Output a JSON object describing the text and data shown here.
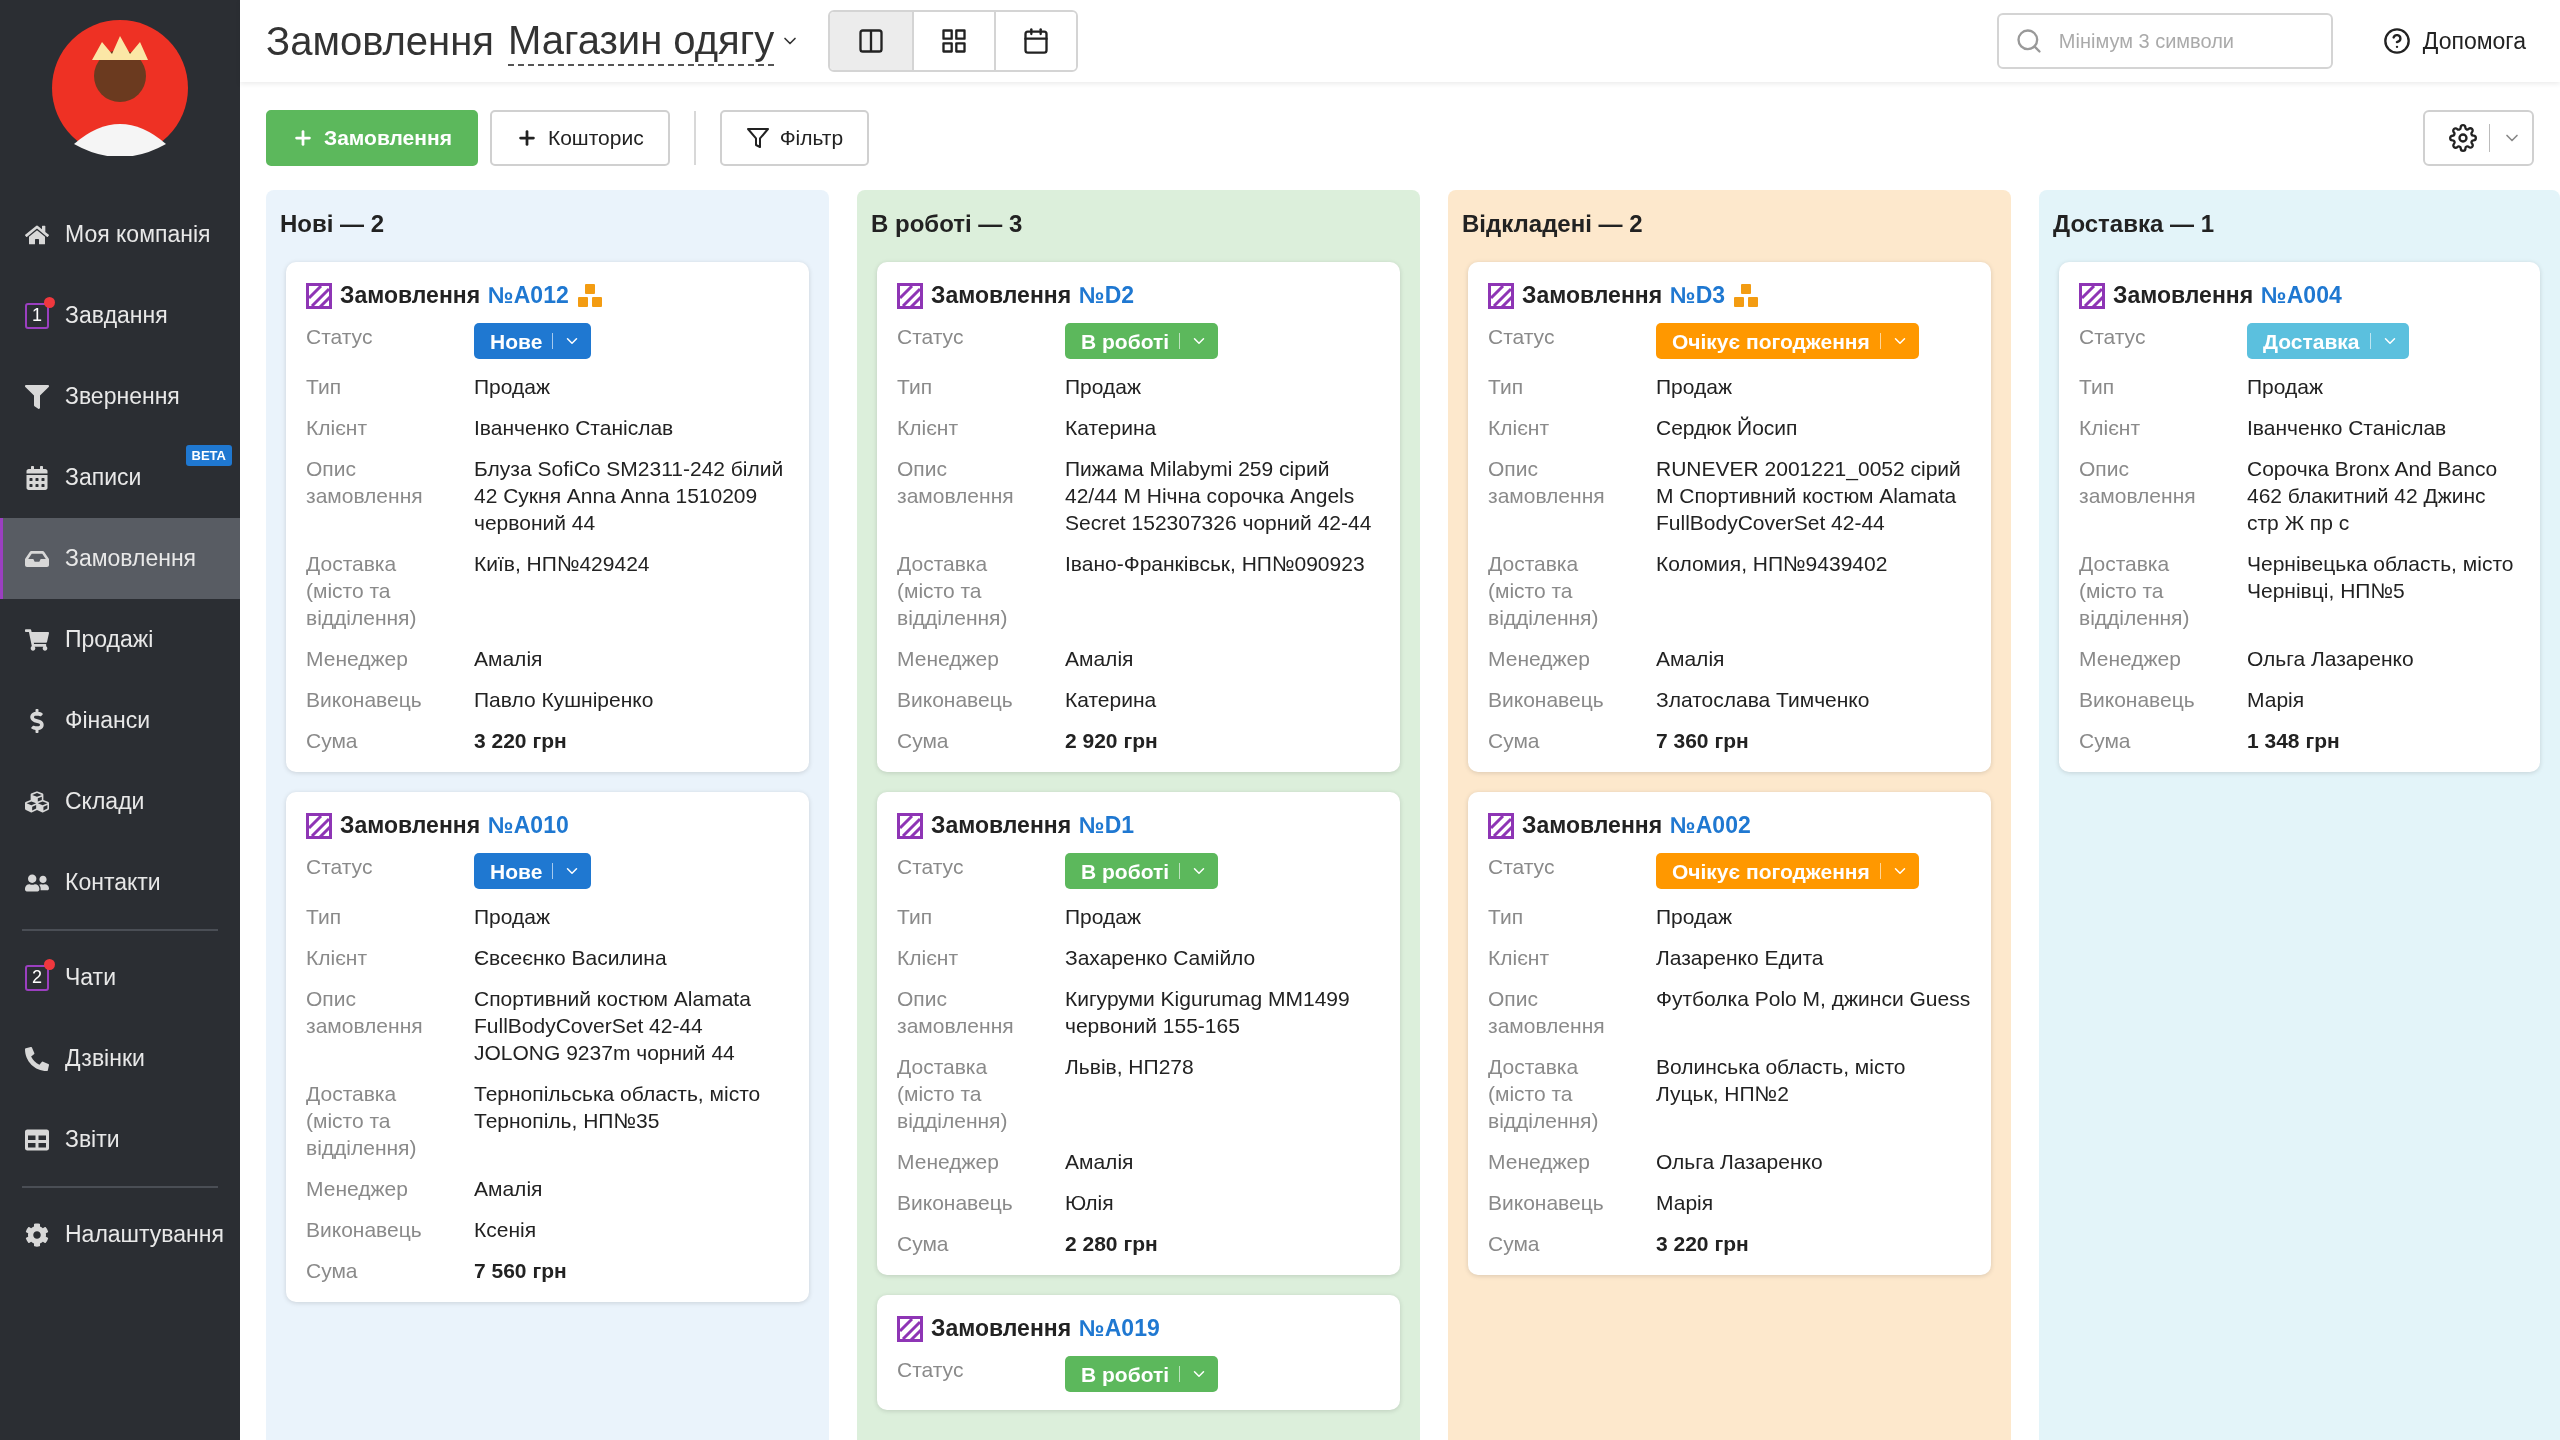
{
  "sidebar": {
    "groups": [
      [
        {
          "label": "Моя компанія",
          "selected": false
        },
        {
          "label": "Завдання",
          "selected": false,
          "counter": "1",
          "unread": true
        },
        {
          "label": "Звернення",
          "selected": false
        },
        {
          "label": "Записи",
          "selected": false,
          "tag": "BETA"
        },
        {
          "label": "Замовлення",
          "selected": true
        },
        {
          "label": "Продажі",
          "selected": false
        },
        {
          "label": "Фінанси",
          "selected": false
        },
        {
          "label": "Склади",
          "selected": false
        },
        {
          "label": "Контакти",
          "selected": false
        }
      ],
      [
        {
          "label": "Чати",
          "selected": false,
          "counter": "2",
          "unread": true
        },
        {
          "label": "Дзвінки",
          "selected": false
        },
        {
          "label": "Звіти",
          "selected": false
        }
      ],
      [
        {
          "label": "Налаштування",
          "selected": false
        }
      ]
    ]
  },
  "header": {
    "title": "Замовлення",
    "store": "Магазин одягу",
    "views": [
      {
        "selected": true
      },
      {
        "selected": false
      },
      {
        "selected": false
      }
    ],
    "search": {
      "placeholder": "Мінімум 3 символи"
    },
    "help": "Допомога"
  },
  "toolbar": {
    "new_order": "Замовлення",
    "estimate": "Кошторис",
    "filter": "Фільтр"
  },
  "columns": [
    {
      "title": "Нові — 2",
      "color": "#eaf3fb",
      "cards": [
        {
          "title": "Замовлення",
          "number": "№A012",
          "stock": true,
          "status": {
            "name": "Статус",
            "label": "Нове",
            "color": "#1f78d1"
          },
          "fields": [
            {
              "label": "Тип",
              "value": "Продаж"
            },
            {
              "label": "Клієнт",
              "value": "Іванченко Станіслав"
            },
            {
              "label": "Опис замовлення",
              "value": "Блуза SofiCo SM2311-242 білий 42 Сукня Anna Anna 1510209 червоний 44"
            },
            {
              "label": "Доставка (місто та відділення)",
              "value": "Київ, НП№429424"
            },
            {
              "label": "Менеджер",
              "value": "Амалія"
            },
            {
              "label": "Виконавець",
              "value": "Павло Кушніренко"
            },
            {
              "label": "Сума",
              "value": "3 220 грн",
              "kind": "total"
            }
          ]
        },
        {
          "title": "Замовлення",
          "number": "№A010",
          "stock": false,
          "status": {
            "name": "Статус",
            "label": "Нове",
            "color": "#1f78d1"
          },
          "fields": [
            {
              "label": "Тип",
              "value": "Продаж"
            },
            {
              "label": "Клієнт",
              "value": "Євсеєнко Василина"
            },
            {
              "label": "Опис замовлення",
              "value": "Спортивний костюм Alamata FullBodyCoverSet 42-44 JOLONG 9237m чорний 44"
            },
            {
              "label": "Доставка (місто та відділення)",
              "value": "Тернопільська область, місто Тернопіль, НП№35"
            },
            {
              "label": "Менеджер",
              "value": "Амалія"
            },
            {
              "label": "Виконавець",
              "value": "Ксенія"
            },
            {
              "label": "Сума",
              "value": "7 560 грн",
              "kind": "total"
            }
          ]
        }
      ]
    },
    {
      "title": "В роботі — 3",
      "color": "#dcefdb",
      "cards": [
        {
          "title": "Замовлення",
          "number": "№D2",
          "stock": false,
          "status": {
            "name": "Статус",
            "label": "В роботі",
            "color": "#5cb85c"
          },
          "fields": [
            {
              "label": "Тип",
              "value": "Продаж"
            },
            {
              "label": "Клієнт",
              "value": "Катерина"
            },
            {
              "label": "Опис замовлення",
              "value": "Пижама Milabymi 259 сірий 42/44 M Нічна сорочка Angels Secret 152307326 чорний 42-44"
            },
            {
              "label": "Доставка (місто та відділення)",
              "value": "Івано-Франківськ, НП№090923"
            },
            {
              "label": "Менеджер",
              "value": "Амалія"
            },
            {
              "label": "Виконавець",
              "value": "Катерина"
            },
            {
              "label": "Сума",
              "value": "2 920 грн",
              "kind": "total"
            }
          ]
        },
        {
          "title": "Замовлення",
          "number": "№D1",
          "stock": false,
          "status": {
            "name": "Статус",
            "label": "В роботі",
            "color": "#5cb85c"
          },
          "fields": [
            {
              "label": "Тип",
              "value": "Продаж"
            },
            {
              "label": "Клієнт",
              "value": "Захаренко Самійло"
            },
            {
              "label": "Опис замовлення",
              "value": "Кигуруми Kigurumag MM1499 червоний 155-165"
            },
            {
              "label": "Доставка (місто та відділення)",
              "value": "Львів, НП278"
            },
            {
              "label": "Менеджер",
              "value": "Амалія"
            },
            {
              "label": "Виконавець",
              "value": "Юлія"
            },
            {
              "label": "Сума",
              "value": "2 280 грн",
              "kind": "total"
            }
          ]
        },
        {
          "title": "Замовлення",
          "number": "№A019",
          "stock": false,
          "status": {
            "name": "Статус",
            "label": "В роботі",
            "color": "#5cb85c"
          }
        }
      ]
    },
    {
      "title": "Відкладені — 2",
      "color": "#fde8cc",
      "cards": [
        {
          "title": "Замовлення",
          "number": "№D3",
          "stock": true,
          "status": {
            "name": "Статус",
            "label": "Очікує погодження",
            "color": "#ff9800"
          },
          "fields": [
            {
              "label": "Тип",
              "value": "Продаж"
            },
            {
              "label": "Клієнт",
              "value": "Сердюк Йосип"
            },
            {
              "label": "Опис замовлення",
              "value": "RUNEVER 2001221_0052 сірий M Спортивний костюм Alamata FullBodyCoverSet 42-44"
            },
            {
              "label": "Доставка (місто та відділення)",
              "value": "Коломия, НП№9439402"
            },
            {
              "label": "Менеджер",
              "value": "Амалія"
            },
            {
              "label": "Виконавець",
              "value": "Златослава Тимченко"
            },
            {
              "label": "Сума",
              "value": "7 360 грн",
              "kind": "total"
            }
          ]
        },
        {
          "title": "Замовлення",
          "number": "№A002",
          "stock": false,
          "status": {
            "name": "Статус",
            "label": "Очікує погодження",
            "color": "#ff9800"
          },
          "fields": [
            {
              "label": "Тип",
              "value": "Продаж"
            },
            {
              "label": "Клієнт",
              "value": "Лазаренко Едита"
            },
            {
              "label": "Опис замовлення",
              "value": "Футболка Polo M, джинси Guess"
            },
            {
              "label": "Доставка (місто та відділення)",
              "value": "Волинська область, місто Луцьк, НП№2"
            },
            {
              "label": "Менеджер",
              "value": "Ольга Лазаренко"
            },
            {
              "label": "Виконавець",
              "value": "Марія"
            },
            {
              "label": "Сума",
              "value": "3 220 грн",
              "kind": "total"
            }
          ]
        }
      ]
    },
    {
      "title": "Доставка — 1",
      "color": "#e3f4f9",
      "cards": [
        {
          "title": "Замовлення",
          "number": "№A004",
          "stock": false,
          "status": {
            "name": "Статус",
            "label": "Доставка",
            "color": "#5bc0de"
          },
          "fields": [
            {
              "label": "Тип",
              "value": "Продаж"
            },
            {
              "label": "Клієнт",
              "value": "Іванченко Станіслав"
            },
            {
              "label": "Опис замовлення",
              "value": "Сорочка Bronx And Banco 462 блакитний 42 Джинс стр Ж пр с"
            },
            {
              "label": "Доставка (місто та відділення)",
              "value": "Чернівецька область, місто Чернівці, НП№5"
            },
            {
              "label": "Менеджер",
              "value": "Ольга Лазаренко"
            },
            {
              "label": "Виконавець",
              "value": "Марія"
            },
            {
              "label": "Сума",
              "value": "1 348 грн",
              "kind": "total"
            }
          ]
        }
      ]
    }
  ]
}
